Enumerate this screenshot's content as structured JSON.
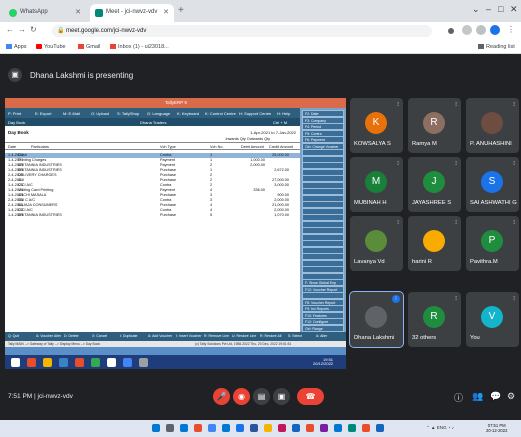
{
  "browser": {
    "tabs": [
      {
        "title": "WhatsApp",
        "active": false
      },
      {
        "title": "Meet - jci-nwvz-vdv",
        "active": true
      }
    ],
    "url": "meet.google.com/jci-nwvz-vdv",
    "bookmarks": [
      "Apps",
      "YouTube",
      "Gmail",
      "Inbox (1) - ui23018..."
    ],
    "reading_list": "Reading list"
  },
  "meet": {
    "presenter_text": "Dhana Lakshmi is presenting",
    "time": "7:51 PM",
    "meeting_code": "jci-nwvz-vdv",
    "others_label": "32 others"
  },
  "tally": {
    "window_title": "TallyERP 9",
    "top_menu": [
      "P: Print",
      "E: Export",
      "M: E-Mail",
      "O: Upload",
      "S: TallyShop",
      "G: Language",
      "K: Keyboard",
      "K: Control Centre",
      "H: Support Centre",
      "H: Help"
    ],
    "sub_left": "Day Book",
    "sub_center": "Dhana Traders",
    "sub_right": "Ctrl + M",
    "title": "Day Book",
    "range": "1-Apr-2021 to 7-Jan-2022",
    "vv": "Inwards Qty   Outwards Qty",
    "columns": {
      "date": "Date",
      "particulars": "Particulars",
      "vch_type": "Vch Type",
      "vch_no": "Vch No.",
      "debit": "Debit Amount",
      "credit": "Credit Amount"
    },
    "rows": [
      {
        "date": "1-4-2021",
        "particulars": "Cash",
        "vch_type": "Contra",
        "vch_no": "1",
        "debit": "",
        "credit": "25,000.00"
      },
      {
        "date": "1-4-2021",
        "particulars": "Printing Charges",
        "vch_type": "Payment",
        "vch_no": "1",
        "debit": "1,000.00",
        "credit": ""
      },
      {
        "date": "1-4-2021",
        "particulars": "BRITANNIA INDUSTRIES",
        "vch_type": "Payment",
        "vch_no": "2",
        "debit": "2,000.00",
        "credit": ""
      },
      {
        "date": "1-4-2021",
        "particulars": "BRITANNIA INDUSTRIES",
        "vch_type": "Purchase",
        "vch_no": "1",
        "debit": "",
        "credit": "2,672.00"
      },
      {
        "date": "2-4-2021",
        "particulars": "DELIVERY CHARGES",
        "vch_type": "Purchase",
        "vch_no": "2",
        "debit": "",
        "credit": ""
      },
      {
        "date": "2-4-2021",
        "particulars": "ALI",
        "vch_type": "Purchase",
        "vch_no": "2",
        "debit": "",
        "credit": "27,000.00"
      },
      {
        "date": "1-4-2021",
        "particulars": "CICI A/C",
        "vch_type": "Contra",
        "vch_no": "2",
        "debit": "",
        "credit": "3,000.00"
      },
      {
        "date": "1-4-2021",
        "particulars": "Visiting Card Printing",
        "vch_type": "Payment",
        "vch_no": "4",
        "debit": "336.00",
        "credit": ""
      },
      {
        "date": "1-4-2021",
        "particulars": "ANCHI MASALA",
        "vch_type": "Purchase",
        "vch_no": "3",
        "debit": "",
        "credit": "900.00"
      },
      {
        "date": "2-4-2021",
        "particulars": "SBI C A/C",
        "vch_type": "Contra",
        "vch_no": "3",
        "debit": "",
        "credit": "2,000.00"
      },
      {
        "date": "2-4-2021",
        "particulars": "BAJAJA CONSUMERS",
        "vch_type": "Purchase",
        "vch_no": "4",
        "debit": "",
        "credit": "21,000.00"
      },
      {
        "date": "1-4-2021",
        "particulars": "CICI A/C",
        "vch_type": "Contra",
        "vch_no": "4",
        "debit": "",
        "credit": "2,000.00"
      },
      {
        "date": "1-4-2021",
        "particulars": "BRITANNIA INDUSTRIES",
        "vch_type": "Purchase",
        "vch_no": "5",
        "debit": "",
        "credit": "1,070.00"
      }
    ],
    "right_buttons": [
      "F2: Date",
      "F3: Company",
      "F4: Period",
      "F5: Contra",
      "F6: Payment",
      "Ctrl: Change Voucher",
      "",
      "",
      "",
      "",
      "",
      "",
      "",
      "",
      "",
      "",
      "",
      "",
      "",
      "",
      "",
      "",
      "",
      "",
      "",
      "",
      "F: Show Global Exp",
      "F12: Voucher Report",
      "",
      "F8: Voucher Report",
      "F9: Inv Reports",
      "F10: Features",
      "F12: Configure",
      "Ctrl: Range"
    ],
    "bottom_buttons": [
      "Q: Quit",
      "A: Voucher Alter",
      "D: Delete",
      "X: Cancel",
      "I: Duplicate",
      "A: Add Voucher",
      "I: Insert Voucher",
      "R: Remove Line",
      "U: Restore Line",
      "R: Restore All",
      "S: Select",
      "A: Alter"
    ],
    "status_left": "Tally MAIN --> Gateway of Tally --> Display Menu --> Day Book",
    "status_right": "(c) Tally Solutions Pvt Ltd, 1988-2022     Thu, 20 Dec, 2022     19:51:51",
    "clock_time": "19:51",
    "clock_date": "20/12/2022"
  },
  "participants": [
    {
      "name": "KOWSALYA S",
      "initial": "K",
      "color": "#e8710a",
      "type": "avatar"
    },
    {
      "name": "Ramya M",
      "initial": "R",
      "color": "#8d6e63",
      "type": "avatar"
    },
    {
      "name": "P. ANUHASHINI",
      "initial": "",
      "color": "#6d4c41",
      "type": "photo"
    },
    {
      "name": "MUBINAH H",
      "initial": "M",
      "color": "#188038",
      "type": "avatar"
    },
    {
      "name": "JAYASHREE S",
      "initial": "J",
      "color": "#1e8e3e",
      "type": "avatar"
    },
    {
      "name": "SAI ASHWATHI G",
      "initial": "S",
      "color": "#1a73e8",
      "type": "avatar"
    },
    {
      "name": "Lavanya Vd",
      "initial": "",
      "color": "#5b8c3a",
      "type": "photo"
    },
    {
      "name": "harini R",
      "initial": "",
      "color": "#f9ab00",
      "type": "photo"
    },
    {
      "name": "Pavithra.M",
      "initial": "P",
      "color": "#1e8e3e",
      "type": "avatar"
    },
    {
      "name": "Dhana Lakshmi",
      "initial": "",
      "color": "#5f6368",
      "type": "photo"
    },
    {
      "name": "32 others",
      "initial": "R",
      "color": "#1e8e3e",
      "type": "others"
    },
    {
      "name": "You",
      "initial": "V",
      "color": "#12b5cb",
      "type": "avatar"
    }
  ],
  "windows": {
    "clock_time": "07:51 PM",
    "clock_date": "20-12-2022",
    "tray": "ENG"
  }
}
